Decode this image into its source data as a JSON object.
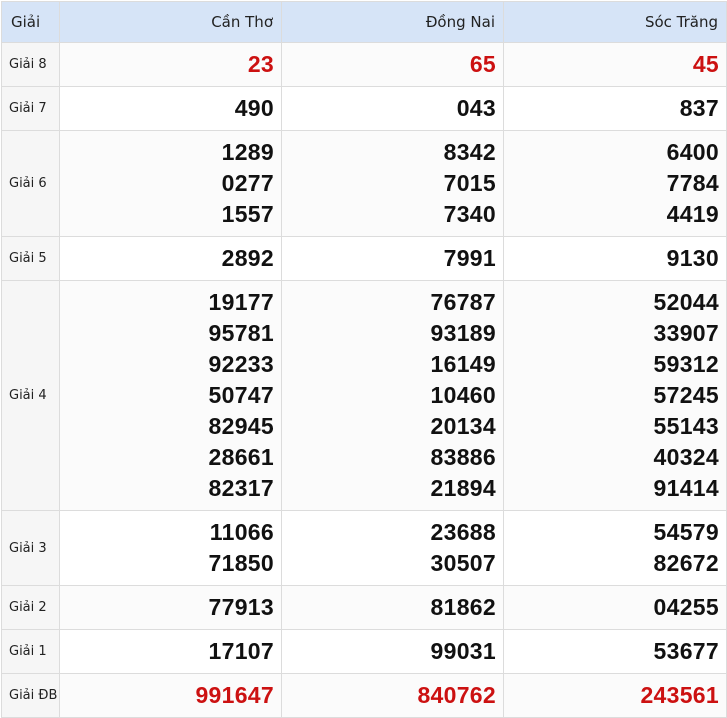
{
  "header": {
    "label": "Giải",
    "provinces": [
      "Cần Thơ",
      "Đồng Nai",
      "Sóc Trăng"
    ]
  },
  "colors": {
    "header_bg": "#d6e4f7",
    "highlight": "#cc1111"
  },
  "rows": [
    {
      "label": "Giải 8",
      "highlight": true,
      "cells": [
        [
          "23"
        ],
        [
          "65"
        ],
        [
          "45"
        ]
      ]
    },
    {
      "label": "Giải 7",
      "highlight": false,
      "cells": [
        [
          "490"
        ],
        [
          "043"
        ],
        [
          "837"
        ]
      ]
    },
    {
      "label": "Giải 6",
      "highlight": false,
      "cells": [
        [
          "1289",
          "0277",
          "1557"
        ],
        [
          "8342",
          "7015",
          "7340"
        ],
        [
          "6400",
          "7784",
          "4419"
        ]
      ]
    },
    {
      "label": "Giải 5",
      "highlight": false,
      "cells": [
        [
          "2892"
        ],
        [
          "7991"
        ],
        [
          "9130"
        ]
      ]
    },
    {
      "label": "Giải 4",
      "highlight": false,
      "cells": [
        [
          "19177",
          "95781",
          "92233",
          "50747",
          "82945",
          "28661",
          "82317"
        ],
        [
          "76787",
          "93189",
          "16149",
          "10460",
          "20134",
          "83886",
          "21894"
        ],
        [
          "52044",
          "33907",
          "59312",
          "57245",
          "55143",
          "40324",
          "91414"
        ]
      ]
    },
    {
      "label": "Giải 3",
      "highlight": false,
      "cells": [
        [
          "11066",
          "71850"
        ],
        [
          "23688",
          "30507"
        ],
        [
          "54579",
          "82672"
        ]
      ]
    },
    {
      "label": "Giải 2",
      "highlight": false,
      "cells": [
        [
          "77913"
        ],
        [
          "81862"
        ],
        [
          "04255"
        ]
      ]
    },
    {
      "label": "Giải 1",
      "highlight": false,
      "cells": [
        [
          "17107"
        ],
        [
          "99031"
        ],
        [
          "53677"
        ]
      ]
    },
    {
      "label": "Giải ĐB",
      "highlight": true,
      "cells": [
        [
          "991647"
        ],
        [
          "840762"
        ],
        [
          "243561"
        ]
      ]
    }
  ]
}
